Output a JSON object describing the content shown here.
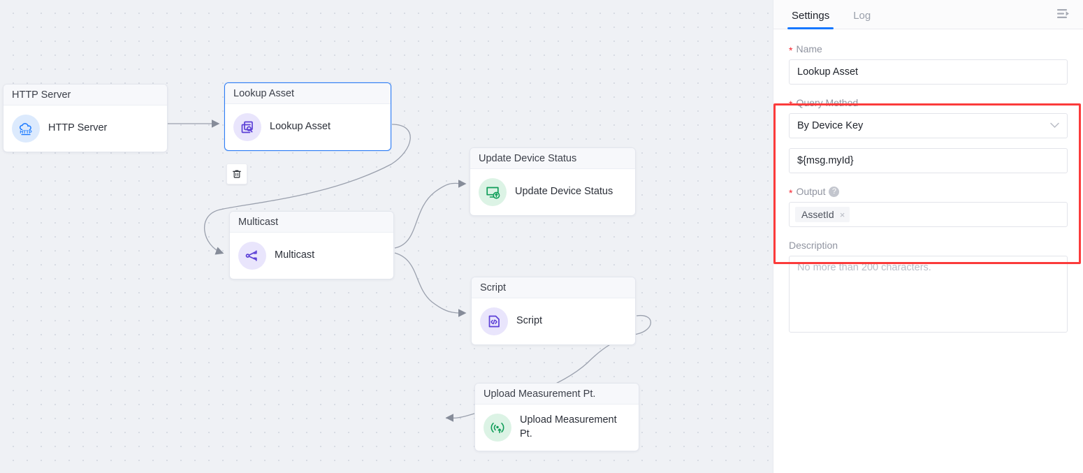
{
  "canvas": {
    "nodes": [
      {
        "title": "HTTP Server",
        "label": "HTTP Server",
        "icon": "http-cloud-icon",
        "color": "#1677ff"
      },
      {
        "title": "Lookup Asset",
        "label": "Lookup Asset",
        "icon": "lookup-asset-icon",
        "color": "#5b3fd6"
      },
      {
        "title": "Multicast",
        "label": "Multicast",
        "icon": "multicast-share-icon",
        "color": "#5b3fd6"
      },
      {
        "title": "Update Device Status",
        "label": "Update Device Status",
        "icon": "update-device-status-icon",
        "color": "#0f9d58"
      },
      {
        "title": "Script",
        "label": "Script",
        "icon": "script-code-icon",
        "color": "#5b3fd6"
      },
      {
        "title": "Upload Measurement Pt.",
        "label": "Upload Measurement Pt.",
        "icon": "upload-measurement-icon",
        "color": "#0f9d58"
      }
    ],
    "delete_tooltip": "Delete"
  },
  "panel": {
    "tabs": [
      {
        "label": "Settings",
        "active": true
      },
      {
        "label": "Log",
        "active": false
      }
    ],
    "collapse_icon": "collapse-panel-icon",
    "form": {
      "name": {
        "label": "Name",
        "required": true,
        "value": "Lookup Asset"
      },
      "query_method": {
        "label": "Query Method",
        "required": true,
        "value": "By Device Key",
        "chevron": "chevron-down-icon"
      },
      "query_value": {
        "value": "${msg.myId}"
      },
      "output": {
        "label": "Output",
        "required": true,
        "help_icon": "question-mark-icon",
        "tags": [
          {
            "label": "AssetId",
            "close": "×"
          }
        ]
      },
      "description": {
        "label": "Description",
        "required": false,
        "value": "",
        "placeholder": "No more than 200 characters."
      }
    },
    "highlight_color": "#fb3b3b"
  }
}
